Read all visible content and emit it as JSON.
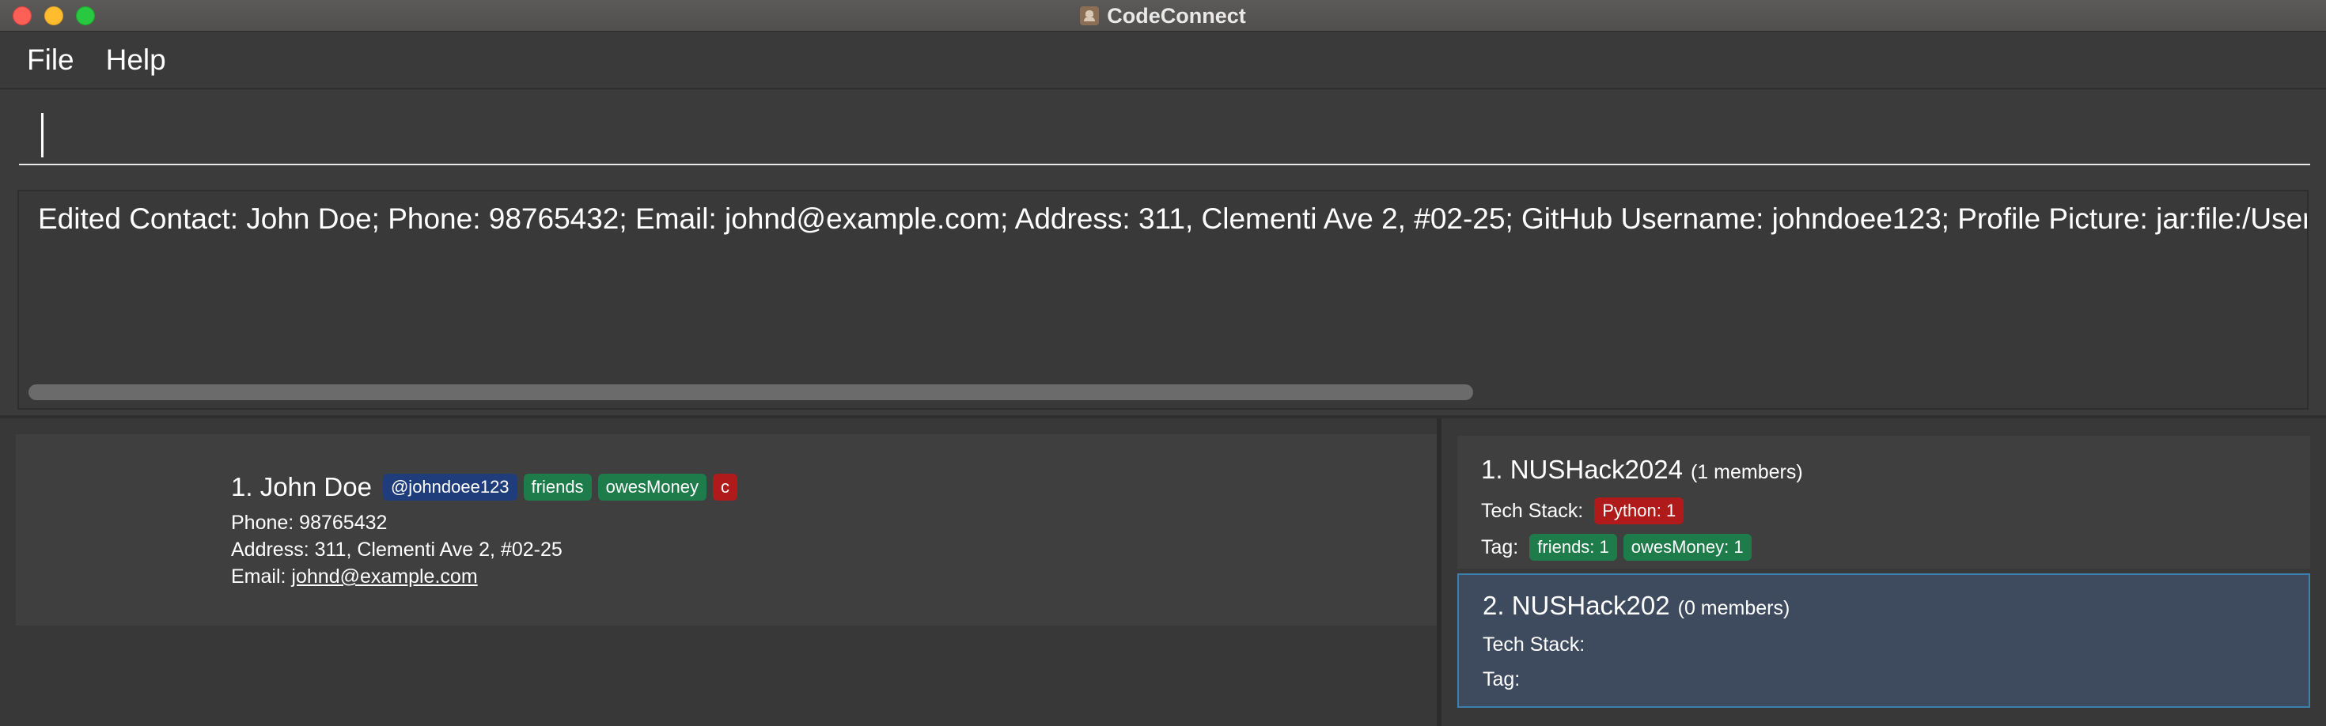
{
  "window": {
    "title": "CodeConnect"
  },
  "menu": {
    "file": "File",
    "help": "Help"
  },
  "command": {
    "value": ""
  },
  "result": {
    "text": "Edited Contact: John Doe; Phone: 98765432; Email: johnd@example.com; Address: 311, Clementi Ave 2, #02-25; GitHub Username: johndoee123; Profile Picture: jar:file:/Users/howen/D"
  },
  "persons": [
    {
      "index": "1.",
      "name": "John Doe",
      "tags": [
        "@johndoee123",
        "friends",
        "owesMoney",
        "c"
      ],
      "phone": "Phone: 98765432",
      "address": "Address: 311, Clementi Ave 2, #02-25",
      "email_label": "Email:",
      "email": "johnd@example.com"
    }
  ],
  "teams": [
    {
      "index": "1.",
      "name": "NUSHack2024",
      "members": "(1 members)",
      "tech_stack_label": "Tech Stack:",
      "tech_stack": [
        "Python: 1"
      ],
      "tag_label": "Tag:",
      "tags": [
        "friends: 1",
        "owesMoney: 1"
      ]
    },
    {
      "index": "2.",
      "name": "NUSHack202",
      "members": "(0 members)",
      "tech_stack_label": "Tech Stack:",
      "tech_stack": [],
      "tag_label": "Tag:",
      "tags": []
    }
  ],
  "colors": {
    "github_tag": "#1f3d7a",
    "green_tag": "#1e7b4a",
    "red_tag": "#b11a1a",
    "selected_card": "#3e4b5e",
    "selected_border": "#3c7fb1"
  }
}
